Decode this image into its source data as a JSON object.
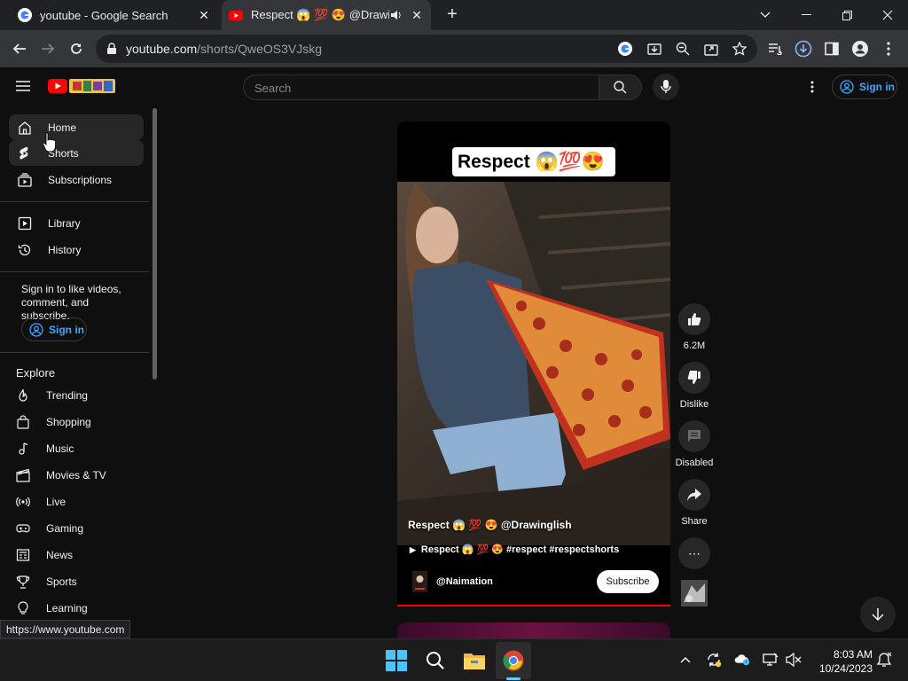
{
  "browser": {
    "tabs": [
      {
        "title": "youtube - Google Search"
      },
      {
        "title": "Respect 😱 💯 😍 @Drawinglish"
      }
    ],
    "new_tab_label": "+",
    "url_host": "youtube.com",
    "url_path": "/shorts/QweOS3VJskg",
    "status_url": "https://www.youtube.com"
  },
  "youtube": {
    "search_placeholder": "Search",
    "signin_label": "Sign in",
    "sidebar": {
      "primary": [
        {
          "label": "Home",
          "icon": "home-icon"
        },
        {
          "label": "Shorts",
          "icon": "shorts-icon"
        },
        {
          "label": "Subscriptions",
          "icon": "subscriptions-icon"
        }
      ],
      "secondary": [
        {
          "label": "Library",
          "icon": "library-icon"
        },
        {
          "label": "History",
          "icon": "history-icon"
        }
      ],
      "signin_prompt": "Sign in to like videos, comment, and subscribe.",
      "signin_label": "Sign in",
      "explore_heading": "Explore",
      "explore": [
        {
          "label": "Trending",
          "icon": "trending-icon"
        },
        {
          "label": "Shopping",
          "icon": "shopping-icon"
        },
        {
          "label": "Music",
          "icon": "music-icon"
        },
        {
          "label": "Movies & TV",
          "icon": "movies-icon"
        },
        {
          "label": "Live",
          "icon": "live-icon"
        },
        {
          "label": "Gaming",
          "icon": "gaming-icon"
        },
        {
          "label": "News",
          "icon": "news-icon"
        },
        {
          "label": "Sports",
          "icon": "sports-icon"
        },
        {
          "label": "Learning",
          "icon": "learning-icon"
        }
      ]
    },
    "short": {
      "title_card": "Respect 😱💯😍",
      "overlay_title": "Respect 😱 💯 😍 @Drawinglish",
      "music_line": "Respect 😱 💯 😍 #respect #respectshorts",
      "channel": "@Naimation",
      "subscribe_label": "Subscribe"
    },
    "actions": {
      "like_count": "6.2M",
      "dislike_label": "Dislike",
      "comments_label": "Disabled",
      "share_label": "Share",
      "more_label": "⋯"
    }
  },
  "taskbar": {
    "time": "8:03 AM",
    "date": "10/24/2023"
  },
  "colors": {
    "youtube_red": "#ff0000",
    "link_blue": "#3ea6ff",
    "background": "#0f0f0f"
  }
}
